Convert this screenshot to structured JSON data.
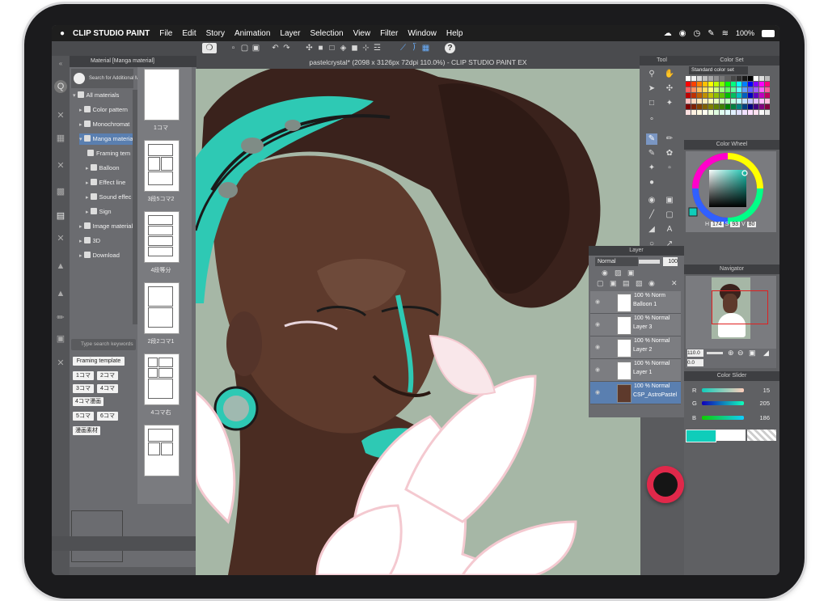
{
  "menubar": {
    "apple": "",
    "app_name": "CLIP STUDIO PAINT",
    "items": [
      "File",
      "Edit",
      "Story",
      "Animation",
      "Layer",
      "Selection",
      "View",
      "Filter",
      "Window",
      "Help"
    ],
    "battery": "100%"
  },
  "document": {
    "title": "pastelcrystal* (2098 x 3126px 72dpi 110.0%)  - CLIP STUDIO PAINT EX"
  },
  "material_panel": {
    "tab_title": "Material [Manga material]",
    "search_additional": "Search for Additional M",
    "tree": [
      {
        "label": "All materials",
        "indent": 0,
        "arrow": "▾"
      },
      {
        "label": "Color pattern",
        "indent": 1,
        "arrow": "▸"
      },
      {
        "label": "Monochromat",
        "indent": 1,
        "arrow": "▸"
      },
      {
        "label": "Manga materia",
        "indent": 1,
        "arrow": "▾",
        "selected": true
      },
      {
        "label": "Framing tem",
        "indent": 2,
        "arrow": ""
      },
      {
        "label": "Balloon",
        "indent": 2,
        "arrow": "▸"
      },
      {
        "label": "Effect line",
        "indent": 2,
        "arrow": "▸"
      },
      {
        "label": "Sound effec",
        "indent": 2,
        "arrow": "▸"
      },
      {
        "label": "Sign",
        "indent": 2,
        "arrow": "▸"
      },
      {
        "label": "Image material",
        "indent": 1,
        "arrow": "▸"
      },
      {
        "label": "3D",
        "indent": 1,
        "arrow": "▸"
      },
      {
        "label": "Download",
        "indent": 1,
        "arrow": "▸"
      }
    ],
    "thumbnails": [
      "1コマ",
      "3段5コマ2",
      "4段等分",
      "2段2コマ1",
      "4コマ右",
      ""
    ],
    "keyword_placeholder": "Type search keywords",
    "tags": [
      "Framing template",
      "1コマ",
      "2コマ",
      "3コマ",
      "4コマ",
      "4コマ漫画",
      "5コマ",
      "6コマ",
      "漫画素材"
    ]
  },
  "tool_panel": {
    "title": "Tool"
  },
  "color_set": {
    "title": "Color Set",
    "set_name": "Standard color set"
  },
  "color_wheel": {
    "title": "Color Wheel",
    "h": "174",
    "s": "93",
    "v": "80",
    "h_label": "H",
    "s_label": "S",
    "v_label": "V"
  },
  "navigator": {
    "title": "Navigator",
    "zoom": "110.0",
    "angle": "0.0"
  },
  "color_slider": {
    "title": "Color Slider",
    "r_label": "R",
    "r": "15",
    "g_label": "G",
    "g": "205",
    "b_label": "B",
    "b": "186",
    "colors": {
      "main": "#0fcdba"
    }
  },
  "layer_panel": {
    "title": "Layer",
    "blend_mode": "Normal",
    "opacity": "100",
    "layers": [
      {
        "mode": "100 % Norm",
        "name": "Balloon 1"
      },
      {
        "mode": "100 % Normal",
        "name": "Layer 3"
      },
      {
        "mode": "100 % Normal",
        "name": "Layer 2"
      },
      {
        "mode": "100 % Normal",
        "name": "Layer 1"
      },
      {
        "mode": "100 % Normal",
        "name": "CSP_AstroPastel"
      }
    ]
  }
}
